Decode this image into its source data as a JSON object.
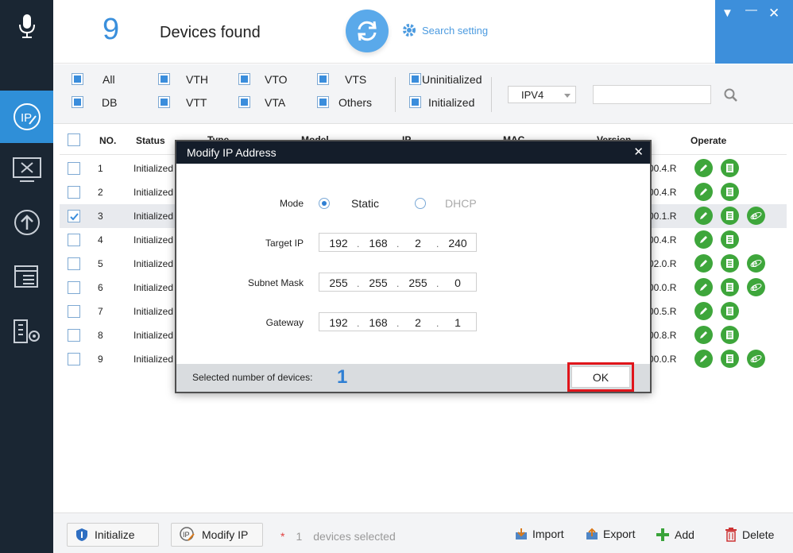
{
  "header": {
    "device_count": "9",
    "found_label": "Devices found",
    "search_setting": "Search setting"
  },
  "filters": {
    "row1": [
      "All",
      "VTH",
      "VTO",
      "VTS",
      "Uninitialized"
    ],
    "row2": [
      "DB",
      "VTT",
      "VTA",
      "Others",
      "Initialized"
    ],
    "ip_version": "IPV4",
    "search_value": ""
  },
  "table": {
    "headers": {
      "no": "NO.",
      "status": "Status",
      "type": "Type",
      "model": "Model",
      "ip": "IP",
      "mac": "MAC",
      "version": "Version",
      "operate": "Operate"
    },
    "rows": [
      {
        "no": "1",
        "status": "Initialized",
        "version": "00.4.R",
        "checked": false,
        "ie": false
      },
      {
        "no": "2",
        "status": "Initialized",
        "version": "00.4.R",
        "checked": false,
        "ie": false
      },
      {
        "no": "3",
        "status": "Initialized",
        "version": "00.1.R",
        "checked": true,
        "ie": true
      },
      {
        "no": "4",
        "status": "Initialized",
        "version": "00.4.R",
        "checked": false,
        "ie": false
      },
      {
        "no": "5",
        "status": "Initialized",
        "version": "02.0.R",
        "checked": false,
        "ie": true
      },
      {
        "no": "6",
        "status": "Initialized",
        "version": "00.0.R",
        "checked": false,
        "ie": true
      },
      {
        "no": "7",
        "status": "Initialized",
        "version": "00.5.R",
        "checked": false,
        "ie": false
      },
      {
        "no": "8",
        "status": "Initialized",
        "version": "00.8.R",
        "checked": false,
        "ie": false
      },
      {
        "no": "9",
        "status": "Initialized",
        "version": "00.0.R",
        "checked": false,
        "ie": true
      }
    ]
  },
  "modal": {
    "title": "Modify IP Address",
    "mode_label": "Mode",
    "mode_static": "Static",
    "mode_dhcp": "DHCP",
    "target_ip_label": "Target IP",
    "target_ip": [
      "192",
      "168",
      "2",
      "240"
    ],
    "subnet_label": "Subnet Mask",
    "subnet": [
      "255",
      "255",
      "255",
      "0"
    ],
    "gateway_label": "Gateway",
    "gateway": [
      "192",
      "168",
      "2",
      "1"
    ],
    "selected_label": "Selected number of devices:",
    "selected_count": "1",
    "ok": "OK"
  },
  "bottom": {
    "initialize": "Initialize",
    "modify_ip": "Modify IP",
    "star": "*",
    "selected_num": "1",
    "selected_text": "devices selected",
    "import": "Import",
    "export": "Export",
    "add": "Add",
    "delete": "Delete"
  },
  "colors": {
    "sidebar": "#1a2633",
    "accent": "#3a8fdc",
    "op_green": "#3ea63b",
    "ok_highlight": "#e0151b"
  }
}
